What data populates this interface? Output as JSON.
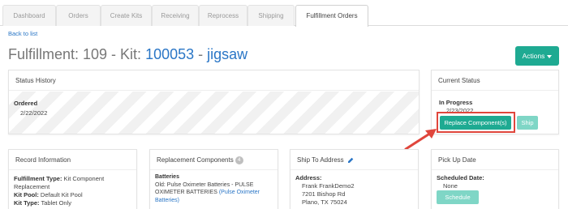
{
  "tabs": [
    "Dashboard",
    "Orders",
    "Create Kits",
    "Receiving",
    "Reprocess",
    "Shipping",
    "Fulfillment Orders"
  ],
  "active_tab": "Fulfillment Orders",
  "back_link": "Back to list",
  "heading": {
    "prefix": "Fulfillment: 109 - Kit: ",
    "kit_number": "100053",
    "separator": " - ",
    "kit_name": "jigsaw"
  },
  "actions_label": "Actions",
  "status_history": {
    "title": "Status History",
    "status": "Ordered",
    "date": "2/22/2022"
  },
  "current_status": {
    "title": "Current Status",
    "status": "In Progress",
    "date": "2/23/2022",
    "replace_button": "Replace Component(s)",
    "ship_button": "Ship"
  },
  "record_info": {
    "title": "Record Information",
    "fulfillment_type_label": "Fulfillment Type:",
    "fulfillment_type_value": " Kit Component",
    "fulfillment_type_cont": "Replacement",
    "kit_pool_label": "Kit Pool:",
    "kit_pool_value": " Default Kit Pool",
    "kit_type_label": "Kit Type:",
    "kit_type_value": " Tablet Only"
  },
  "replacement_components": {
    "title": "Replacement Components",
    "count": "4",
    "category": "Batteries",
    "old_line1": "Old: Pulse Oximeter Batteries - PULSE",
    "old_line2_text": "OXIMETER BATTERIES ",
    "old_line2_link": "(Pulse Oximeter",
    "old_line3_link": "Batteries)"
  },
  "ship_to": {
    "title": "Ship To Address",
    "address_label": "Address:",
    "line1": "Frank FrankDemo2",
    "line2": "7201 Bishop Rd",
    "line3": "Plano, TX 75024"
  },
  "pick_up": {
    "title": "Pick Up Date",
    "scheduled_label": "Scheduled Date:",
    "scheduled_value": "None",
    "schedule_button": "Schedule"
  },
  "colors": {
    "accent": "#1eaa92",
    "accent_light": "#7fd6c6",
    "link": "#2a76c6",
    "highlight": "#e0463c"
  },
  "icons": [
    "pencil-icon",
    "chevron-down-icon",
    "arrow-icon"
  ]
}
